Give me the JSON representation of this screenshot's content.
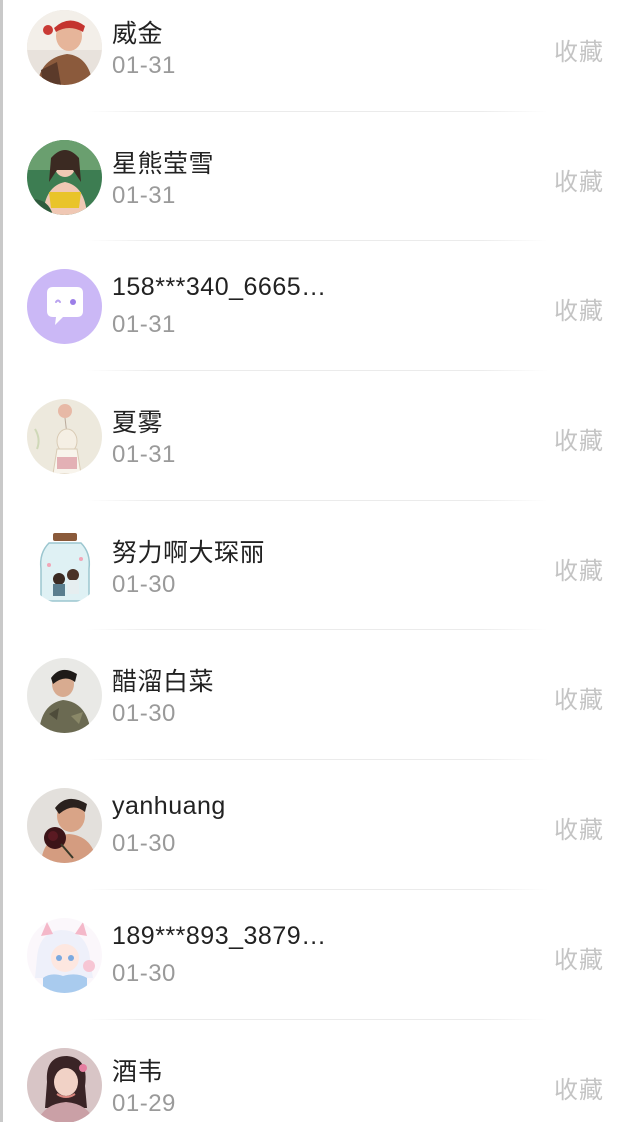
{
  "list": {
    "items": [
      {
        "name": "威金",
        "date": "01-31",
        "action": "收藏",
        "avatar": "avatar-photo-man-red-cap"
      },
      {
        "name": "星熊莹雪",
        "date": "01-31",
        "action": "收藏",
        "avatar": "avatar-photo-woman-yellow-top"
      },
      {
        "name": "158***340_6665…",
        "date": "01-31",
        "action": "收藏",
        "avatar": "default-chat-bubble-icon"
      },
      {
        "name": "夏雾",
        "date": "01-31",
        "action": "收藏",
        "avatar": "avatar-illustration-girl-balloon"
      },
      {
        "name": "努力啊大琛丽",
        "date": "01-30",
        "action": "收藏",
        "avatar": "avatar-illustration-jar-couple"
      },
      {
        "name": "醋溜白菜",
        "date": "01-30",
        "action": "收藏",
        "avatar": "avatar-photo-man-camo-shirt"
      },
      {
        "name": "yanhuang",
        "date": "01-30",
        "action": "收藏",
        "avatar": "avatar-photo-man-rose"
      },
      {
        "name": "189***893_3879…",
        "date": "01-30",
        "action": "收藏",
        "avatar": "avatar-anime-girl"
      },
      {
        "name": "酒韦",
        "date": "01-29",
        "action": "收藏",
        "avatar": "avatar-photo-woman-pink"
      }
    ]
  },
  "colors": {
    "name_text": "#222222",
    "date_text": "#9a9a9a",
    "action_text": "#c4c4c4",
    "default_avatar_bg": "#c8b6f5"
  }
}
